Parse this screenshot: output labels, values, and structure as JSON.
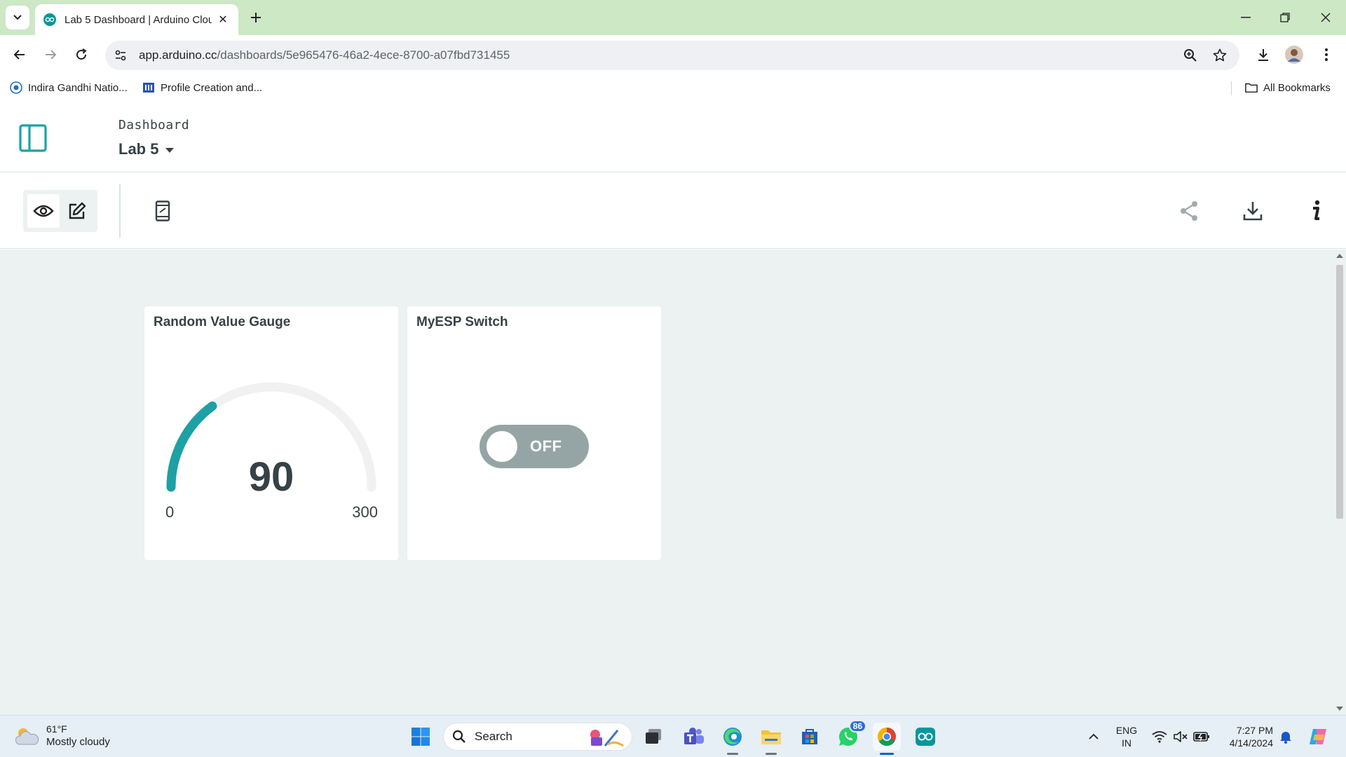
{
  "browser": {
    "tab_title": "Lab 5 Dashboard | Arduino Cloud",
    "url_host": "app.arduino.cc",
    "url_path": "/dashboards/5e965476-46a2-4ece-8700-a07fbd731455",
    "bookmarks": [
      {
        "label": "Indira Gandhi Natio..."
      },
      {
        "label": "Profile Creation and..."
      }
    ],
    "all_bookmarks_label": "All Bookmarks"
  },
  "app": {
    "breadcrumb": "Dashboard",
    "dashboard_name": "Lab 5",
    "accent_color": "#1da1a4",
    "widgets": {
      "gauge": {
        "title": "Random Value Gauge",
        "value": "90",
        "min": "0",
        "max": "300"
      },
      "switch": {
        "title": "MyESP Switch",
        "state": "OFF"
      }
    }
  },
  "taskbar": {
    "weather_temp": "61°F",
    "weather_condition": "Mostly cloudy",
    "search_label": "Search",
    "whatsapp_badge": "86",
    "lang_line1": "ENG",
    "lang_line2": "IN",
    "time": "7:27 PM",
    "date": "4/14/2024"
  }
}
